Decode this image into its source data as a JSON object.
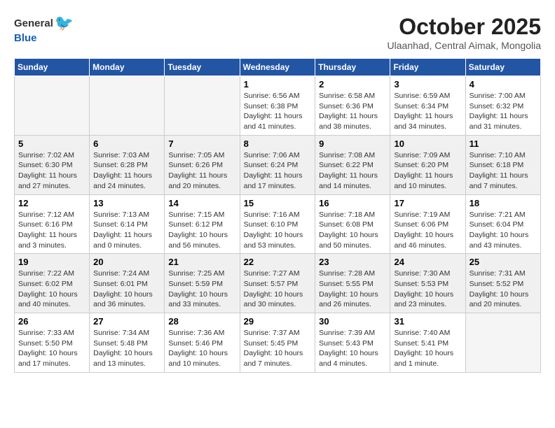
{
  "header": {
    "logo_general": "General",
    "logo_blue": "Blue",
    "month": "October 2025",
    "location": "Ulaanhad, Central Aimak, Mongolia"
  },
  "weekdays": [
    "Sunday",
    "Monday",
    "Tuesday",
    "Wednesday",
    "Thursday",
    "Friday",
    "Saturday"
  ],
  "weeks": [
    [
      {
        "day": "",
        "info": ""
      },
      {
        "day": "",
        "info": ""
      },
      {
        "day": "",
        "info": ""
      },
      {
        "day": "1",
        "info": "Sunrise: 6:56 AM\nSunset: 6:38 PM\nDaylight: 11 hours\nand 41 minutes."
      },
      {
        "day": "2",
        "info": "Sunrise: 6:58 AM\nSunset: 6:36 PM\nDaylight: 11 hours\nand 38 minutes."
      },
      {
        "day": "3",
        "info": "Sunrise: 6:59 AM\nSunset: 6:34 PM\nDaylight: 11 hours\nand 34 minutes."
      },
      {
        "day": "4",
        "info": "Sunrise: 7:00 AM\nSunset: 6:32 PM\nDaylight: 11 hours\nand 31 minutes."
      }
    ],
    [
      {
        "day": "5",
        "info": "Sunrise: 7:02 AM\nSunset: 6:30 PM\nDaylight: 11 hours\nand 27 minutes."
      },
      {
        "day": "6",
        "info": "Sunrise: 7:03 AM\nSunset: 6:28 PM\nDaylight: 11 hours\nand 24 minutes."
      },
      {
        "day": "7",
        "info": "Sunrise: 7:05 AM\nSunset: 6:26 PM\nDaylight: 11 hours\nand 20 minutes."
      },
      {
        "day": "8",
        "info": "Sunrise: 7:06 AM\nSunset: 6:24 PM\nDaylight: 11 hours\nand 17 minutes."
      },
      {
        "day": "9",
        "info": "Sunrise: 7:08 AM\nSunset: 6:22 PM\nDaylight: 11 hours\nand 14 minutes."
      },
      {
        "day": "10",
        "info": "Sunrise: 7:09 AM\nSunset: 6:20 PM\nDaylight: 11 hours\nand 10 minutes."
      },
      {
        "day": "11",
        "info": "Sunrise: 7:10 AM\nSunset: 6:18 PM\nDaylight: 11 hours\nand 7 minutes."
      }
    ],
    [
      {
        "day": "12",
        "info": "Sunrise: 7:12 AM\nSunset: 6:16 PM\nDaylight: 11 hours\nand 3 minutes."
      },
      {
        "day": "13",
        "info": "Sunrise: 7:13 AM\nSunset: 6:14 PM\nDaylight: 11 hours\nand 0 minutes."
      },
      {
        "day": "14",
        "info": "Sunrise: 7:15 AM\nSunset: 6:12 PM\nDaylight: 10 hours\nand 56 minutes."
      },
      {
        "day": "15",
        "info": "Sunrise: 7:16 AM\nSunset: 6:10 PM\nDaylight: 10 hours\nand 53 minutes."
      },
      {
        "day": "16",
        "info": "Sunrise: 7:18 AM\nSunset: 6:08 PM\nDaylight: 10 hours\nand 50 minutes."
      },
      {
        "day": "17",
        "info": "Sunrise: 7:19 AM\nSunset: 6:06 PM\nDaylight: 10 hours\nand 46 minutes."
      },
      {
        "day": "18",
        "info": "Sunrise: 7:21 AM\nSunset: 6:04 PM\nDaylight: 10 hours\nand 43 minutes."
      }
    ],
    [
      {
        "day": "19",
        "info": "Sunrise: 7:22 AM\nSunset: 6:02 PM\nDaylight: 10 hours\nand 40 minutes."
      },
      {
        "day": "20",
        "info": "Sunrise: 7:24 AM\nSunset: 6:01 PM\nDaylight: 10 hours\nand 36 minutes."
      },
      {
        "day": "21",
        "info": "Sunrise: 7:25 AM\nSunset: 5:59 PM\nDaylight: 10 hours\nand 33 minutes."
      },
      {
        "day": "22",
        "info": "Sunrise: 7:27 AM\nSunset: 5:57 PM\nDaylight: 10 hours\nand 30 minutes."
      },
      {
        "day": "23",
        "info": "Sunrise: 7:28 AM\nSunset: 5:55 PM\nDaylight: 10 hours\nand 26 minutes."
      },
      {
        "day": "24",
        "info": "Sunrise: 7:30 AM\nSunset: 5:53 PM\nDaylight: 10 hours\nand 23 minutes."
      },
      {
        "day": "25",
        "info": "Sunrise: 7:31 AM\nSunset: 5:52 PM\nDaylight: 10 hours\nand 20 minutes."
      }
    ],
    [
      {
        "day": "26",
        "info": "Sunrise: 7:33 AM\nSunset: 5:50 PM\nDaylight: 10 hours\nand 17 minutes."
      },
      {
        "day": "27",
        "info": "Sunrise: 7:34 AM\nSunset: 5:48 PM\nDaylight: 10 hours\nand 13 minutes."
      },
      {
        "day": "28",
        "info": "Sunrise: 7:36 AM\nSunset: 5:46 PM\nDaylight: 10 hours\nand 10 minutes."
      },
      {
        "day": "29",
        "info": "Sunrise: 7:37 AM\nSunset: 5:45 PM\nDaylight: 10 hours\nand 7 minutes."
      },
      {
        "day": "30",
        "info": "Sunrise: 7:39 AM\nSunset: 5:43 PM\nDaylight: 10 hours\nand 4 minutes."
      },
      {
        "day": "31",
        "info": "Sunrise: 7:40 AM\nSunset: 5:41 PM\nDaylight: 10 hours\nand 1 minute."
      },
      {
        "day": "",
        "info": ""
      }
    ]
  ]
}
